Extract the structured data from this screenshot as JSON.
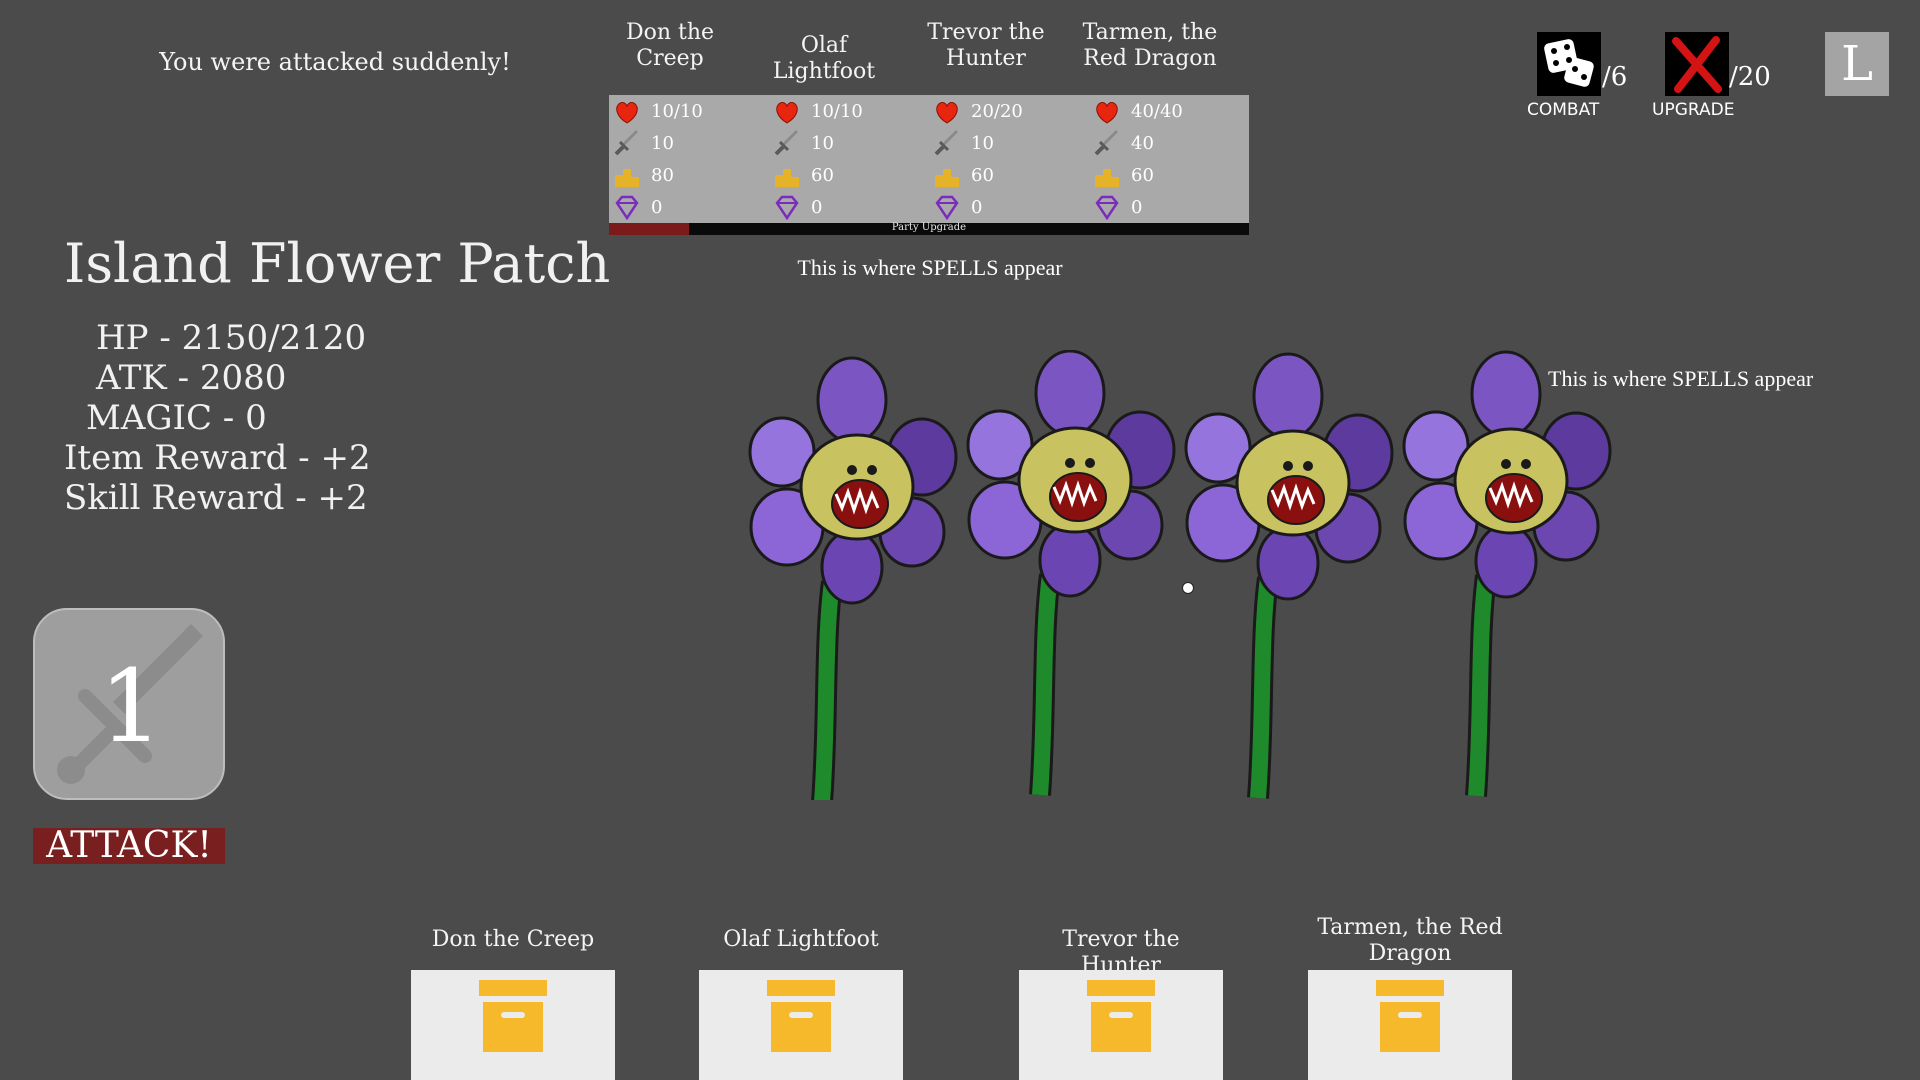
{
  "message": "You were attacked suddenly!",
  "party": [
    {
      "name": "Don the Creep",
      "hp": "10/10",
      "atk": "10",
      "gold": "80",
      "gems": "0"
    },
    {
      "name": "Olaf Lightfoot",
      "hp": "10/10",
      "atk": "10",
      "gold": "60",
      "gems": "0"
    },
    {
      "name": "Trevor the Hunter",
      "hp": "20/20",
      "atk": "10",
      "gold": "60",
      "gems": "0"
    },
    {
      "name": "Tarmen, the Red Dragon",
      "hp": "40/40",
      "atk": "40",
      "gold": "60",
      "gems": "0"
    }
  ],
  "party_upgrade": {
    "label": "Party Upgrade",
    "progress": 0.125
  },
  "spells_placeholder": "This is where SPELLS appear",
  "spells_placeholder_2": "This is where SPELLS appear",
  "enemy": {
    "name": "Island Flower Patch",
    "hp": "HP - 2150/2120",
    "atk": "ATK - 2080",
    "magic": "MAGIC - 0",
    "item_reward": "Item Reward - +2",
    "skill_reward": "Skill Reward - +2"
  },
  "top_right": {
    "combat_count": "/6",
    "combat_label": "COMBAT",
    "upgrade_count": "/20",
    "upgrade_label": "UPGRADE",
    "l_button": "L"
  },
  "skill": {
    "number": "1"
  },
  "attack_label": "ATTACK!",
  "inventory": [
    {
      "name": "Don the Creep"
    },
    {
      "name": "Olaf Lightfoot"
    },
    {
      "name": "Trevor the Hunter"
    },
    {
      "name": "Tarmen, the Red Dragon"
    }
  ],
  "colors": {
    "background": "#4b4b4b",
    "attack": "#7a1f1f",
    "stat_panel": "#a9a9a9",
    "box_icon": "#f6b92c"
  },
  "icons": [
    "heart-icon",
    "sword-icon",
    "gold-icon",
    "gem-icon",
    "dice-icon",
    "x-icon",
    "box-icon"
  ]
}
